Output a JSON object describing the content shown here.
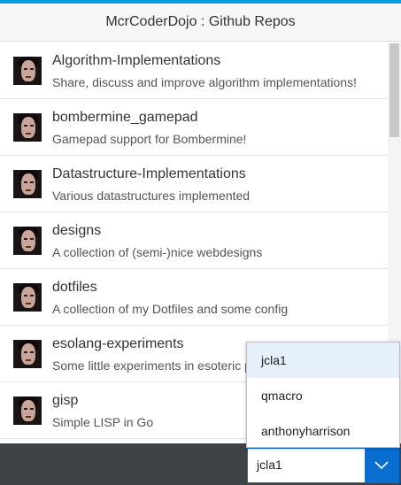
{
  "header": {
    "title": "McrCoderDojo : Github Repos"
  },
  "repos": [
    {
      "name": "Algorithm-Implementations",
      "description": "Share, discuss and improve algorithm implementations!"
    },
    {
      "name": "bombermine_gamepad",
      "description": "Gamepad support for Bombermine!"
    },
    {
      "name": "Datastructure-Implementations",
      "description": "Various datastructures implemented"
    },
    {
      "name": "designs",
      "description": "A collection of (semi-)nice webdesigns"
    },
    {
      "name": "dotfiles",
      "description": "A collection of my Dotfiles and some config"
    },
    {
      "name": "esolang-experiments",
      "description": "Some little experiments in esoteric p"
    },
    {
      "name": "gisp",
      "description": "Simple LISP in Go"
    }
  ],
  "user_select": {
    "selected": "jcla1",
    "options": [
      "jcla1",
      "qmacro",
      "anthonyharrison"
    ]
  },
  "colors": {
    "accent": "#009de0",
    "select_accent": "#0a6ed1",
    "footer": "#3e4347"
  }
}
